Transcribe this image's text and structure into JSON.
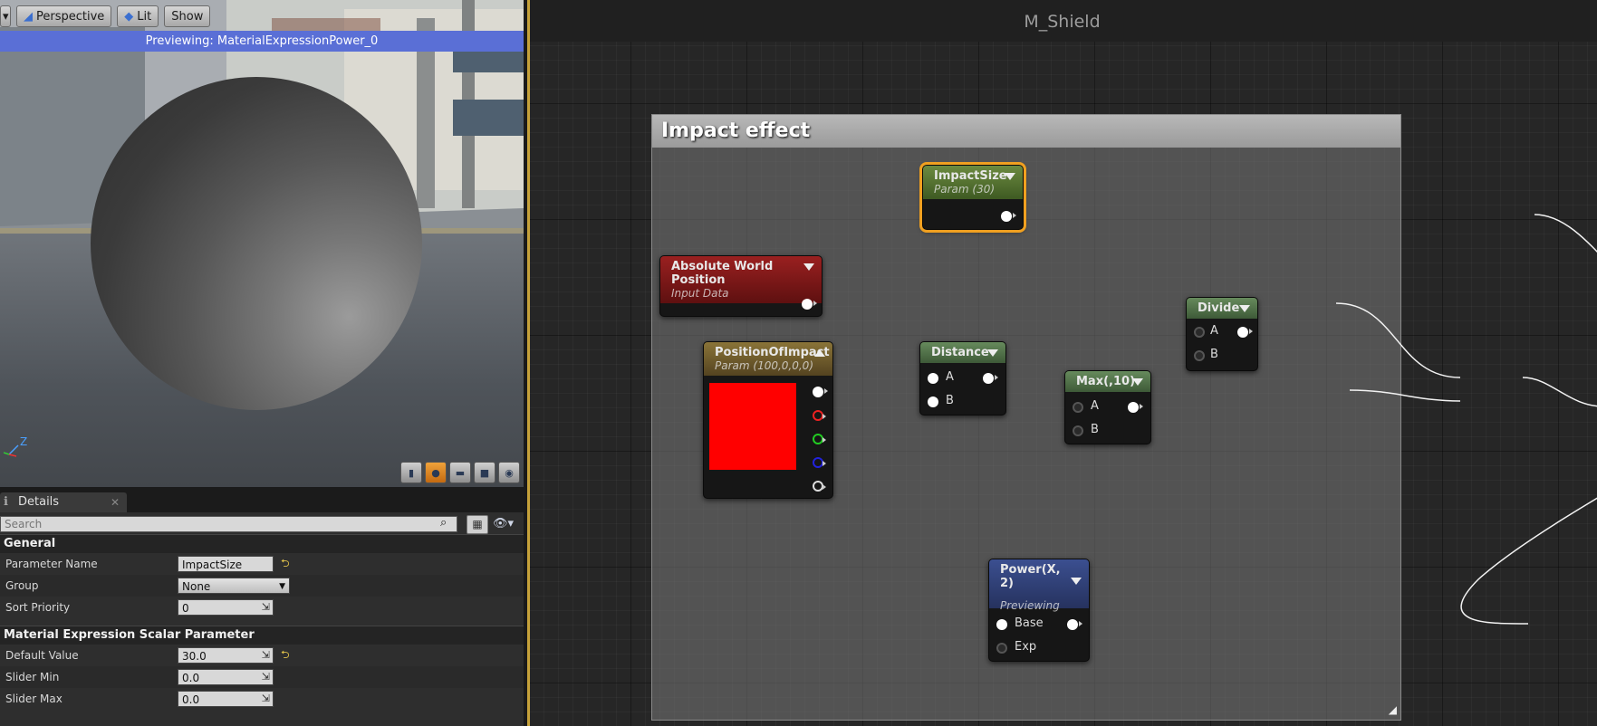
{
  "viewport": {
    "toolbar": {
      "perspective_label": "Perspective",
      "lit_label": "Lit",
      "show_label": "Show"
    },
    "preview_banner": "Previewing: MaterialExpressionPower_0",
    "axis_label": "Z",
    "bottom_icons": [
      "cylinder-icon",
      "sphere-icon",
      "plane-icon",
      "cube-icon",
      "custom-mesh-icon"
    ]
  },
  "details": {
    "tab_label": "Details",
    "search_placeholder": "Search",
    "sections": {
      "general": {
        "title": "General",
        "parameter_name_label": "Parameter Name",
        "parameter_name_value": "ImpactSize",
        "group_label": "Group",
        "group_value": "None",
        "sort_priority_label": "Sort Priority",
        "sort_priority_value": "0"
      },
      "scalar": {
        "title": "Material Expression Scalar Parameter",
        "default_value_label": "Default Value",
        "default_value": "30.0",
        "slider_min_label": "Slider Min",
        "slider_min_value": "0.0",
        "slider_max_label": "Slider Max",
        "slider_max_value": "0.0"
      }
    }
  },
  "graph": {
    "title": "M_Shield",
    "comment_title": "Impact effect",
    "nodes": {
      "impact_size": {
        "title": "ImpactSize",
        "subtitle": "Param (30)"
      },
      "abs_world_pos": {
        "title": "Absolute World Position",
        "subtitle": "Input Data"
      },
      "position_of_impact": {
        "title": "PositionOfImpact",
        "subtitle": "Param (100,0,0,0)",
        "swatch_color": "#ff0000"
      },
      "distance": {
        "title": "Distance",
        "pin_a": "A",
        "pin_b": "B"
      },
      "max": {
        "title": "Max(,10)",
        "pin_a": "A",
        "pin_b": "B"
      },
      "divide": {
        "title": "Divide",
        "pin_a": "A",
        "pin_b": "B"
      },
      "power": {
        "title": "Power(X, 2)",
        "subtitle": "Previewing",
        "pin_base": "Base",
        "pin_exp": "Exp"
      }
    }
  },
  "colors": {
    "preview_banner": "#5a6fd6",
    "selection": "#f0a020",
    "param_node": "#5d7a35",
    "input_node": "#8a1a1a",
    "vector_param_node": "#7a6a32",
    "math_node": "#4f6c48",
    "preview_node": "#2f3f78"
  }
}
